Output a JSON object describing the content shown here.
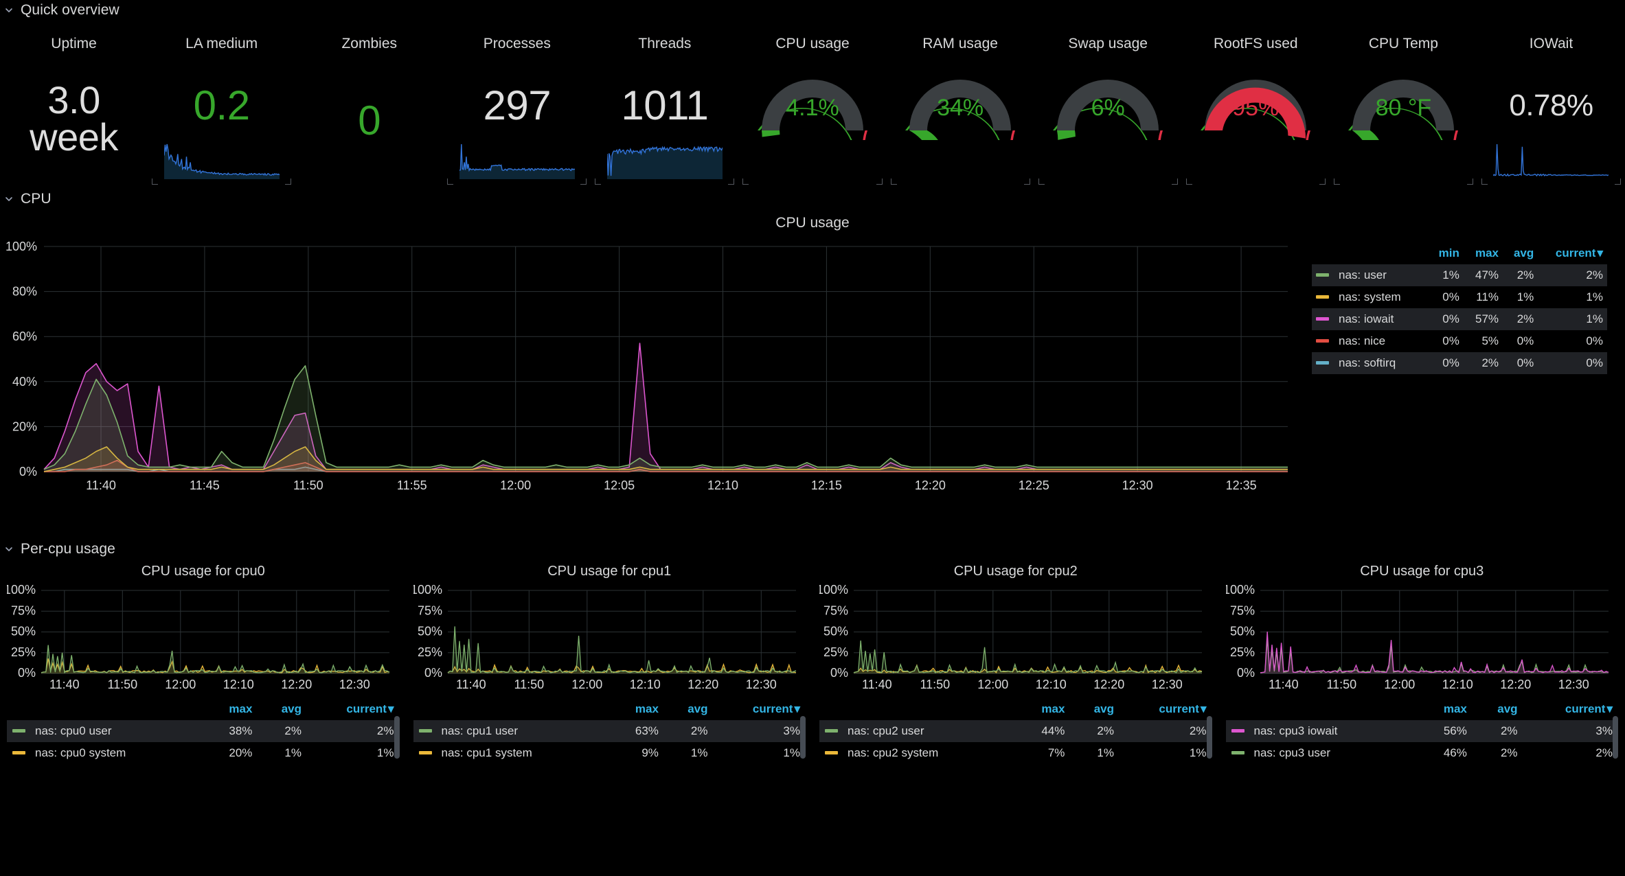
{
  "sections": {
    "quick_overview": {
      "title": "Quick overview",
      "chevron": "chevron-down-icon"
    },
    "cpu": {
      "title": "CPU",
      "chevron": "chevron-down-icon"
    },
    "percpu": {
      "title": "Per-cpu usage",
      "chevron": "chevron-down-icon"
    }
  },
  "overview": [
    {
      "title": "Uptime",
      "value": "3.0\nweek",
      "value_line1": "3.0",
      "value_line2": "week",
      "kind": "stat",
      "color": "#dedede",
      "sparkline": false
    },
    {
      "title": "LA medium",
      "value": "0.2",
      "kind": "stat",
      "color": "#37a72b",
      "sparkline": true
    },
    {
      "title": "Zombies",
      "value": "0",
      "kind": "stat",
      "color": "#37a72b",
      "sparkline": false
    },
    {
      "title": "Processes",
      "value": "297",
      "kind": "stat",
      "color": "#dedede",
      "sparkline": true
    },
    {
      "title": "Threads",
      "value": "1011",
      "kind": "stat",
      "color": "#dedede",
      "sparkline": true
    },
    {
      "title": "CPU usage",
      "value": "4.1%",
      "kind": "gauge",
      "pct": 4.1,
      "color": "#37a72b"
    },
    {
      "title": "RAM usage",
      "value": "34%",
      "kind": "gauge",
      "pct": 34,
      "color": "#37a72b"
    },
    {
      "title": "Swap usage",
      "value": "6%",
      "kind": "gauge",
      "pct": 6,
      "color": "#37a72b"
    },
    {
      "title": "RootFS used",
      "value": "95%",
      "kind": "gauge",
      "pct": 95,
      "color": "#e02f44"
    },
    {
      "title": "CPU Temp",
      "value": "80 °F",
      "kind": "gauge",
      "pct": 30,
      "color": "#37a72b"
    },
    {
      "title": "IOWait",
      "value": "0.78%",
      "kind": "stat",
      "color": "#dedede",
      "sparkline": true
    }
  ],
  "chart_data": [
    {
      "id": "cpu-usage-main",
      "type": "area",
      "title": "CPU usage",
      "xlabel": "",
      "ylabel": "",
      "ylim": [
        0,
        100
      ],
      "yticks": [
        "0%",
        "20%",
        "40%",
        "60%",
        "80%",
        "100%"
      ],
      "xticks": [
        "11:40",
        "11:45",
        "11:50",
        "11:55",
        "12:00",
        "12:05",
        "12:10",
        "12:15",
        "12:20",
        "12:25",
        "12:30",
        "12:35"
      ],
      "grid": true,
      "legend_position": "right",
      "series": [
        {
          "name": "nas: user",
          "color": "#7eb26d",
          "min": "1%",
          "max": "47%",
          "avg": "2%",
          "current": "2%",
          "values": [
            1,
            3,
            8,
            18,
            30,
            41,
            34,
            22,
            7,
            3,
            2,
            2,
            2,
            3,
            2,
            2,
            2,
            9,
            4,
            2,
            2,
            2,
            14,
            28,
            41,
            47,
            25,
            4,
            2,
            2,
            2,
            2,
            2,
            2,
            3,
            2,
            2,
            2,
            3,
            2,
            2,
            2,
            5,
            3,
            2,
            2,
            2,
            2,
            2,
            3,
            2,
            2,
            2,
            3,
            2,
            2,
            3,
            6,
            3,
            2,
            2,
            2,
            2,
            3,
            2,
            2,
            2,
            3,
            2,
            2,
            3,
            2,
            2,
            4,
            2,
            2,
            2,
            3,
            2,
            2,
            2,
            6,
            3,
            2,
            2,
            2,
            2,
            2,
            2,
            2,
            3,
            2,
            2,
            2,
            3,
            2,
            2,
            2,
            2,
            2,
            2,
            2,
            2,
            2,
            2,
            2,
            2,
            2,
            2,
            2,
            2,
            2,
            2,
            2,
            2,
            2,
            2,
            2,
            2,
            2
          ]
        },
        {
          "name": "nas: system",
          "color": "#eab839",
          "min": "0%",
          "max": "11%",
          "avg": "1%",
          "current": "1%",
          "values": [
            0,
            1,
            2,
            4,
            6,
            9,
            11,
            6,
            2,
            1,
            1,
            1,
            1,
            1,
            1,
            1,
            1,
            2,
            1,
            1,
            1,
            1,
            3,
            6,
            9,
            11,
            5,
            1,
            1,
            1,
            1,
            1,
            1,
            1,
            1,
            1,
            1,
            1,
            1,
            1,
            1,
            1,
            2,
            1,
            1,
            1,
            1,
            1,
            1,
            1,
            1,
            1,
            1,
            1,
            1,
            1,
            1,
            2,
            1,
            1,
            1,
            1,
            1,
            1,
            1,
            1,
            1,
            1,
            1,
            1,
            1,
            1,
            1,
            1,
            1,
            1,
            1,
            1,
            1,
            1,
            1,
            2,
            1,
            1,
            1,
            1,
            1,
            1,
            1,
            1,
            1,
            1,
            1,
            1,
            1,
            1,
            1,
            1,
            1,
            1,
            1,
            1,
            1,
            1,
            1,
            1,
            1,
            1,
            1,
            1,
            1,
            1,
            1,
            1,
            1,
            1,
            1,
            1,
            1,
            1
          ]
        },
        {
          "name": "nas: iowait",
          "color": "#dd56cf",
          "min": "0%",
          "max": "57%",
          "avg": "2%",
          "current": "1%",
          "values": [
            1,
            6,
            18,
            32,
            44,
            48,
            40,
            36,
            39,
            9,
            2,
            38,
            2,
            1,
            2,
            1,
            2,
            3,
            1,
            1,
            1,
            1,
            9,
            17,
            25,
            26,
            7,
            1,
            1,
            1,
            1,
            1,
            1,
            1,
            1,
            1,
            1,
            1,
            2,
            1,
            1,
            1,
            3,
            2,
            1,
            1,
            1,
            1,
            1,
            1,
            1,
            1,
            1,
            2,
            1,
            1,
            2,
            57,
            8,
            1,
            1,
            1,
            1,
            2,
            1,
            1,
            1,
            2,
            1,
            1,
            2,
            1,
            1,
            3,
            1,
            1,
            1,
            2,
            1,
            1,
            1,
            4,
            2,
            1,
            1,
            1,
            1,
            1,
            1,
            1,
            2,
            1,
            1,
            1,
            2,
            1,
            1,
            1,
            1,
            1,
            1,
            1,
            1,
            1,
            1,
            1,
            1,
            1,
            1,
            1,
            1,
            1,
            1,
            1,
            1,
            1,
            1,
            1,
            1,
            1
          ]
        },
        {
          "name": "nas: nice",
          "color": "#e24d42",
          "min": "0%",
          "max": "5%",
          "avg": "0%",
          "current": "0%",
          "values": [
            0,
            0,
            0,
            1,
            1,
            2,
            3,
            5,
            2,
            0,
            0,
            0,
            0,
            0,
            0,
            0,
            0,
            0,
            0,
            0,
            0,
            0,
            1,
            2,
            3,
            4,
            2,
            0,
            0,
            0,
            0,
            0,
            0,
            0,
            0,
            0,
            0,
            0,
            0,
            0,
            0,
            0,
            0,
            0,
            0,
            0,
            0,
            0,
            0,
            0,
            0,
            0,
            0,
            0,
            0,
            0,
            0,
            1,
            0,
            0,
            0,
            0,
            0,
            0,
            0,
            0,
            0,
            0,
            0,
            0,
            0,
            0,
            0,
            0,
            0,
            0,
            0,
            0,
            0,
            0,
            0,
            0,
            0,
            0,
            0,
            0,
            0,
            0,
            0,
            0,
            0,
            0,
            0,
            0,
            0,
            0,
            0,
            0,
            0,
            0,
            0,
            0,
            0,
            0,
            0,
            0,
            0,
            0,
            0,
            0,
            0,
            0,
            0,
            0,
            0,
            0,
            0,
            0,
            0,
            0
          ]
        },
        {
          "name": "nas: softirq",
          "color": "#64b0c8",
          "min": "0%",
          "max": "2%",
          "avg": "0%",
          "current": "0%",
          "values": [
            0,
            0,
            1,
            1,
            1,
            1,
            1,
            1,
            1,
            0,
            0,
            1,
            0,
            0,
            0,
            0,
            0,
            0,
            0,
            0,
            0,
            0,
            1,
            1,
            1,
            2,
            1,
            0,
            0,
            0,
            0,
            0,
            0,
            0,
            0,
            0,
            0,
            0,
            0,
            0,
            0,
            0,
            0,
            0,
            0,
            0,
            0,
            0,
            0,
            0,
            0,
            0,
            0,
            0,
            0,
            0,
            0,
            1,
            0,
            0,
            0,
            0,
            0,
            0,
            0,
            0,
            0,
            0,
            0,
            0,
            0,
            0,
            0,
            0,
            0,
            0,
            0,
            0,
            0,
            0,
            0,
            0,
            0,
            0,
            0,
            0,
            0,
            0,
            0,
            0,
            0,
            0,
            0,
            0,
            0,
            0,
            0,
            0,
            0,
            0,
            0,
            0,
            0,
            0,
            0,
            0,
            0,
            0,
            0,
            0,
            0,
            0,
            0,
            0,
            0,
            0,
            0,
            0,
            0,
            0
          ]
        }
      ],
      "legend_columns": [
        "min",
        "max",
        "avg",
        "current"
      ]
    },
    {
      "id": "cpu0",
      "type": "area",
      "title": "CPU usage for cpu0",
      "ylim": [
        0,
        100
      ],
      "yticks": [
        "0%",
        "25%",
        "50%",
        "75%",
        "100%"
      ],
      "xticks": [
        "11:40",
        "11:50",
        "12:00",
        "12:10",
        "12:20",
        "12:30"
      ],
      "legend_columns": [
        "max",
        "avg",
        "current"
      ],
      "series": [
        {
          "name": "nas: cpu0 user",
          "color": "#7eb26d",
          "max": "38%",
          "avg": "2%",
          "current": "2%"
        },
        {
          "name": "nas: cpu0 system",
          "color": "#eab839",
          "max": "20%",
          "avg": "1%",
          "current": "1%"
        }
      ]
    },
    {
      "id": "cpu1",
      "type": "area",
      "title": "CPU usage for cpu1",
      "ylim": [
        0,
        100
      ],
      "yticks": [
        "0%",
        "25%",
        "50%",
        "75%",
        "100%"
      ],
      "xticks": [
        "11:40",
        "11:50",
        "12:00",
        "12:10",
        "12:20",
        "12:30"
      ],
      "legend_columns": [
        "max",
        "avg",
        "current"
      ],
      "series": [
        {
          "name": "nas: cpu1 user",
          "color": "#7eb26d",
          "max": "63%",
          "avg": "2%",
          "current": "3%"
        },
        {
          "name": "nas: cpu1 system",
          "color": "#eab839",
          "max": "9%",
          "avg": "1%",
          "current": "1%"
        }
      ]
    },
    {
      "id": "cpu2",
      "type": "area",
      "title": "CPU usage for cpu2",
      "ylim": [
        0,
        100
      ],
      "yticks": [
        "0%",
        "25%",
        "50%",
        "75%",
        "100%"
      ],
      "xticks": [
        "11:40",
        "11:50",
        "12:00",
        "12:10",
        "12:20",
        "12:30"
      ],
      "legend_columns": [
        "max",
        "avg",
        "current"
      ],
      "series": [
        {
          "name": "nas: cpu2 user",
          "color": "#7eb26d",
          "max": "44%",
          "avg": "2%",
          "current": "2%"
        },
        {
          "name": "nas: cpu2 system",
          "color": "#eab839",
          "max": "7%",
          "avg": "1%",
          "current": "1%"
        }
      ]
    },
    {
      "id": "cpu3",
      "type": "area",
      "title": "CPU usage for cpu3",
      "ylim": [
        0,
        100
      ],
      "yticks": [
        "0%",
        "25%",
        "50%",
        "75%",
        "100%"
      ],
      "xticks": [
        "11:40",
        "11:50",
        "12:00",
        "12:10",
        "12:20",
        "12:30"
      ],
      "legend_columns": [
        "max",
        "avg",
        "current"
      ],
      "series": [
        {
          "name": "nas: cpu3 iowait",
          "color": "#dd56cf",
          "max": "56%",
          "avg": "2%",
          "current": "3%"
        },
        {
          "name": "nas: cpu3 user",
          "color": "#7eb26d",
          "max": "46%",
          "avg": "2%",
          "current": "2%"
        }
      ]
    }
  ],
  "colors": {
    "green": "#37a72b",
    "red": "#e02f44",
    "orange": "#ef843c",
    "gauge_track": "#3b3f42",
    "accent_blue": "#33b5e5",
    "sparkline_blue": "#3274d9",
    "grid": "#2c3235",
    "text": "#d8d9da"
  }
}
